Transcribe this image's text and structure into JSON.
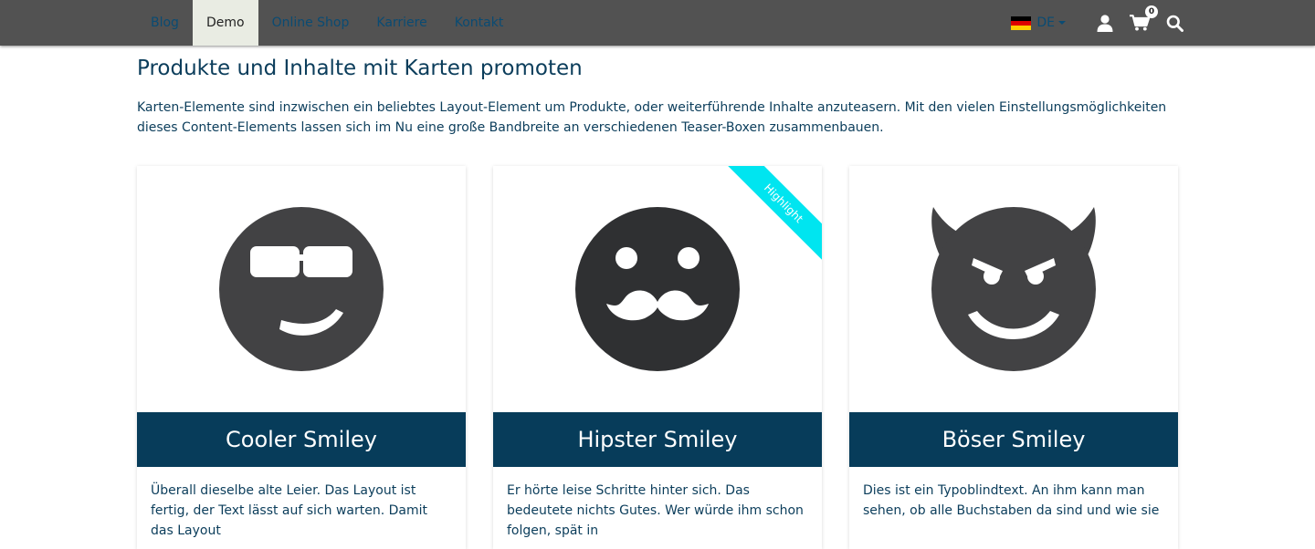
{
  "nav": {
    "items": [
      {
        "label": "Blog"
      },
      {
        "label": "Demo"
      },
      {
        "label": "Online Shop"
      },
      {
        "label": "Karriere"
      },
      {
        "label": "Kontakt"
      }
    ],
    "active": "Demo"
  },
  "tools": {
    "language": "DE",
    "flag_icon": "germany-flag-icon",
    "account_icon": "user-icon",
    "cart_icon": "shopping-cart-icon",
    "cart_count": "0",
    "search_icon": "search-icon"
  },
  "page": {
    "title": "Produkte und Inhalte mit Karten promoten",
    "intro": "Karten-Elemente sind inzwischen ein beliebtes Layout-Element um Produkte, oder weiterführende Inhalte anzuteasern. Mit den vielen Einstellungsmöglichkeiten dieses Content-Elements lassen sich im Nu eine große Bandbreite an verschiedenen Teaser-Boxen zusammenbauen."
  },
  "cards": [
    {
      "title": "Cooler Smiley",
      "icon": "cool-smiley-icon",
      "text": "Überall dieselbe alte Leier. Das Layout ist fertig, der Text lässt auf sich warten. Damit das Layout"
    },
    {
      "title": "Hipster Smiley",
      "icon": "mustache-smiley-icon",
      "ribbon": "Highlight",
      "text": "Er hörte leise Schritte hinter sich. Das bedeutete nichts Gutes. Wer würde ihm schon folgen, spät in"
    },
    {
      "title": "Böser Smiley",
      "icon": "devil-smiley-icon",
      "text": "Dies ist ein Typoblindtext. An ihm kann man sehen, ob alle Buchstaben da sind und wie sie"
    }
  ],
  "colors": {
    "topbar": "#525252",
    "nav_link": "#0a4b73",
    "active_tab_bg": "#e9ece3",
    "card_header_bg": "#073c5a",
    "ribbon": "#00e5f0",
    "smiley": "#424244",
    "text": "#0b3d5b"
  }
}
